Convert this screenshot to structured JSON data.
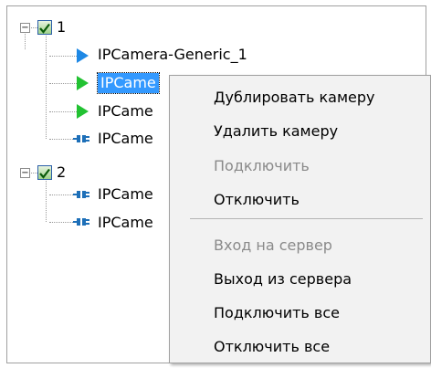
{
  "tree": {
    "group1": {
      "label": "1",
      "expander": "−"
    },
    "group2": {
      "label": "2",
      "expander": "−"
    },
    "cameras": [
      {
        "label": "IPCamera-Generic_1",
        "status_icon": "blue-outline-play-icon"
      },
      {
        "label": "IPCame",
        "status_icon": "green-play-icon",
        "selected": true
      },
      {
        "label": "IPCame",
        "status_icon": "green-play-icon"
      },
      {
        "label": "IPCame",
        "status_icon": "plug-icon"
      },
      {
        "label": "IPCame",
        "status_icon": "plug-icon"
      },
      {
        "label": "IPCame",
        "status_icon": "plug-icon"
      }
    ]
  },
  "context_menu": {
    "items": [
      {
        "label": "Дублировать камеру",
        "enabled": true
      },
      {
        "label": "Удалить камеру",
        "enabled": true
      },
      {
        "label": "Подключить",
        "enabled": false
      },
      {
        "label": "Отключить",
        "enabled": true
      },
      {
        "label": "Вход на сервер",
        "enabled": false
      },
      {
        "label": "Выход из сервера",
        "enabled": true
      },
      {
        "label": "Подключить все",
        "enabled": true
      },
      {
        "label": "Отключить все",
        "enabled": true
      }
    ]
  },
  "colors": {
    "selection": "#3399ff",
    "checkbox_border": "#2c5fa8",
    "play_blue": "#1e88e5",
    "play_green": "#22c232",
    "plug_blue": "#1d6fb8",
    "disabled_text": "#8a8a8a"
  }
}
